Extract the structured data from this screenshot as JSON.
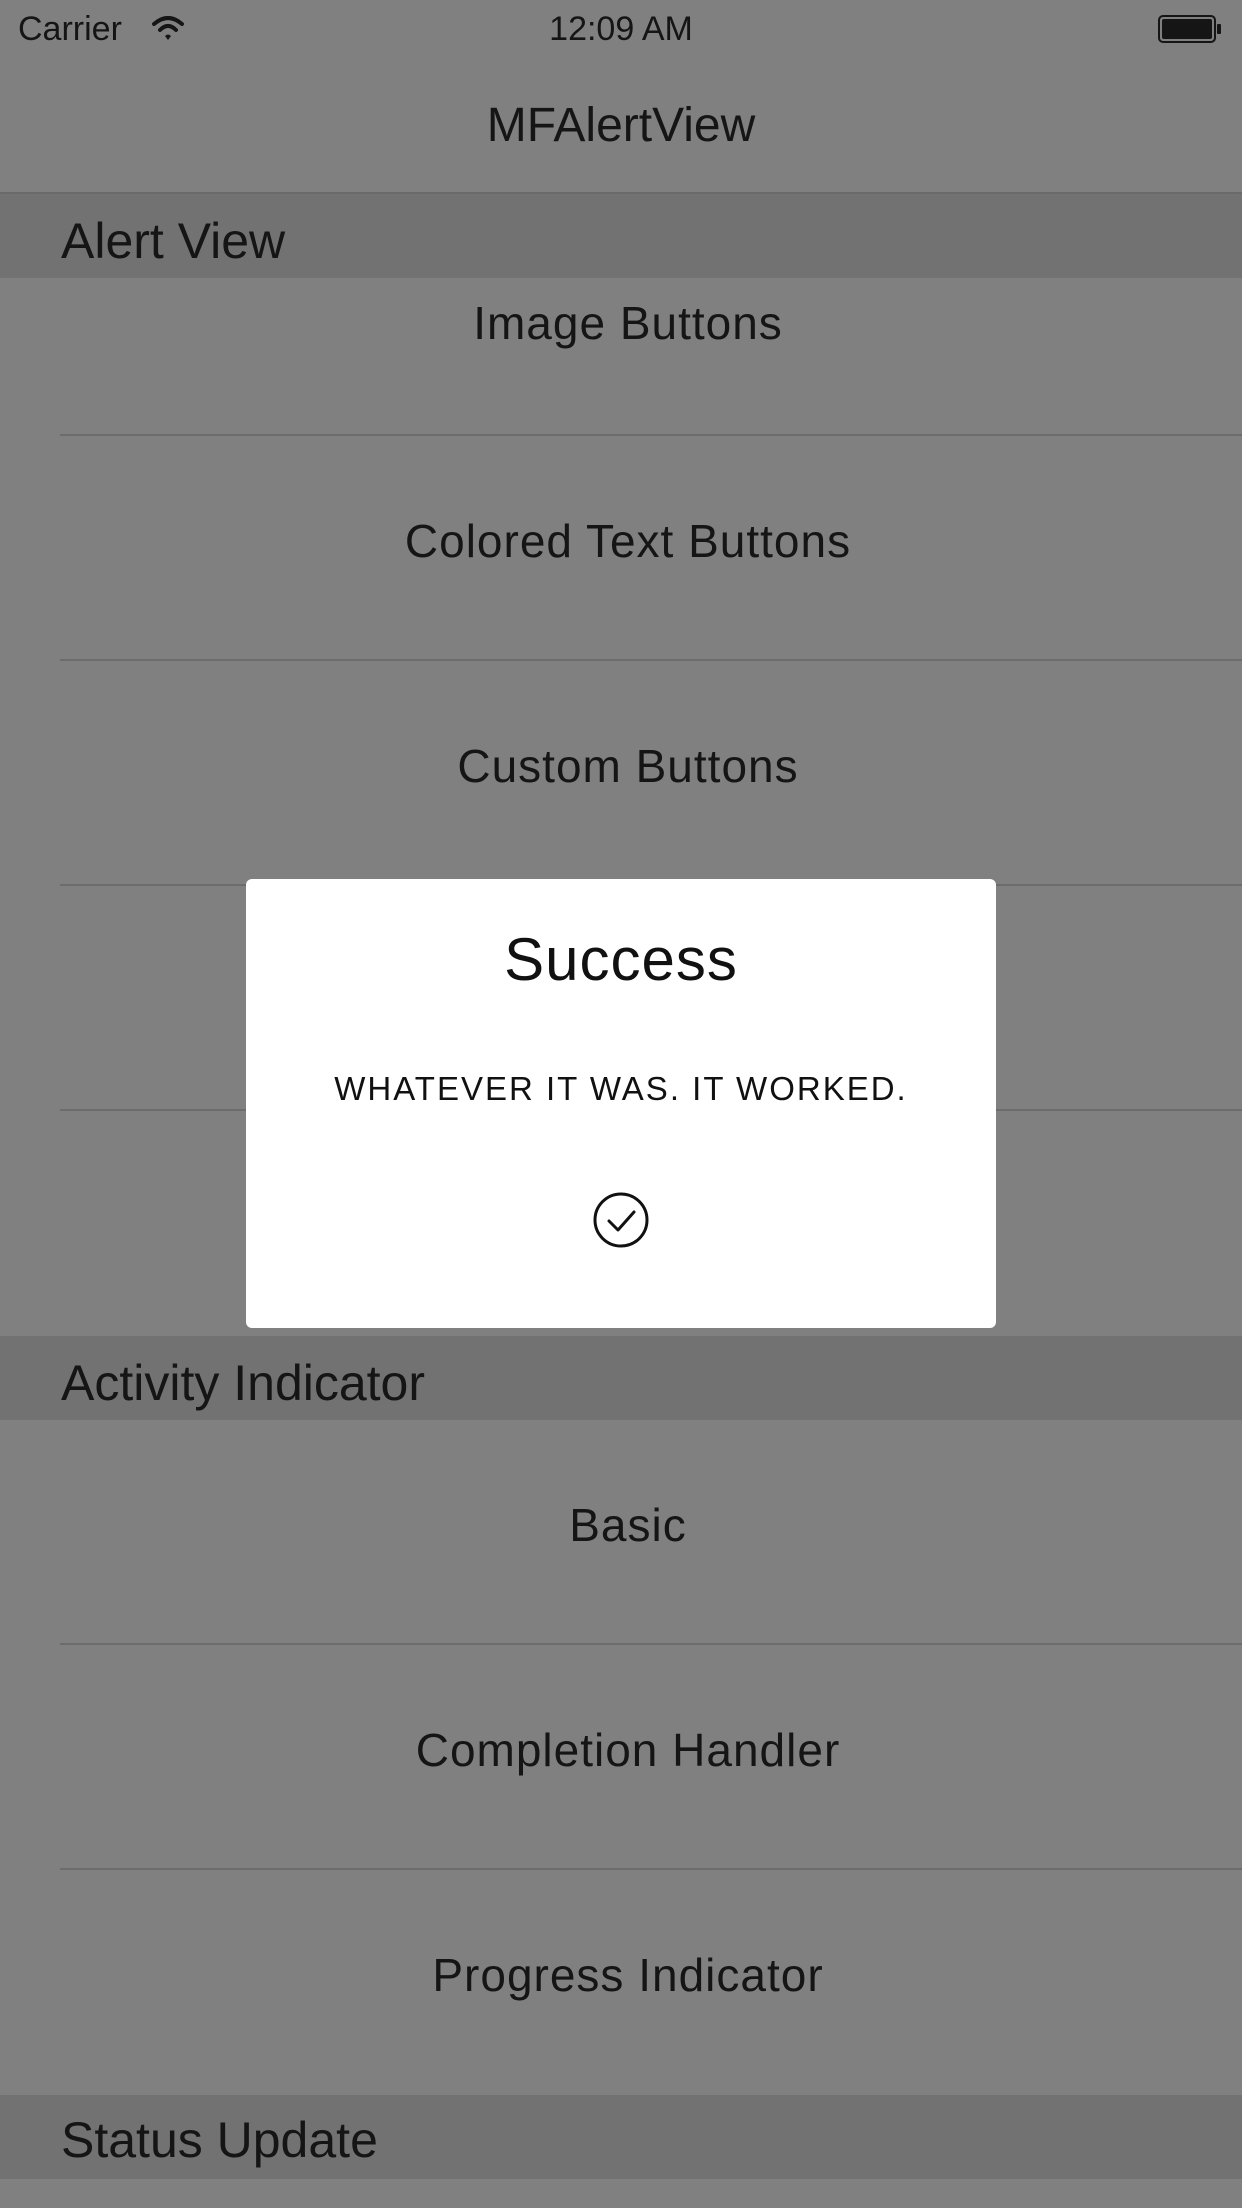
{
  "status_bar": {
    "carrier": "Carrier",
    "time": "12:09 AM"
  },
  "nav": {
    "title": "MFAlertView"
  },
  "sections": [
    {
      "title": "Alert View",
      "rows": [
        "Image Buttons",
        "Colored Text Buttons",
        "Custom Buttons",
        "",
        ""
      ]
    },
    {
      "title": "Activity Indicator",
      "rows": [
        "Basic",
        "Completion Handler",
        "Progress Indicator"
      ]
    },
    {
      "title": "Status Update",
      "rows": []
    }
  ],
  "alert": {
    "title": "Success",
    "message": "WHATEVER IT WAS. IT WORKED.",
    "icon": "checkmark-circle-icon"
  },
  "colors": {
    "dimmed_background": "#808080",
    "section_header": "#727272",
    "alert_background": "#ffffff"
  },
  "icons": {
    "wifi": "wifi-icon",
    "battery": "battery-icon"
  }
}
